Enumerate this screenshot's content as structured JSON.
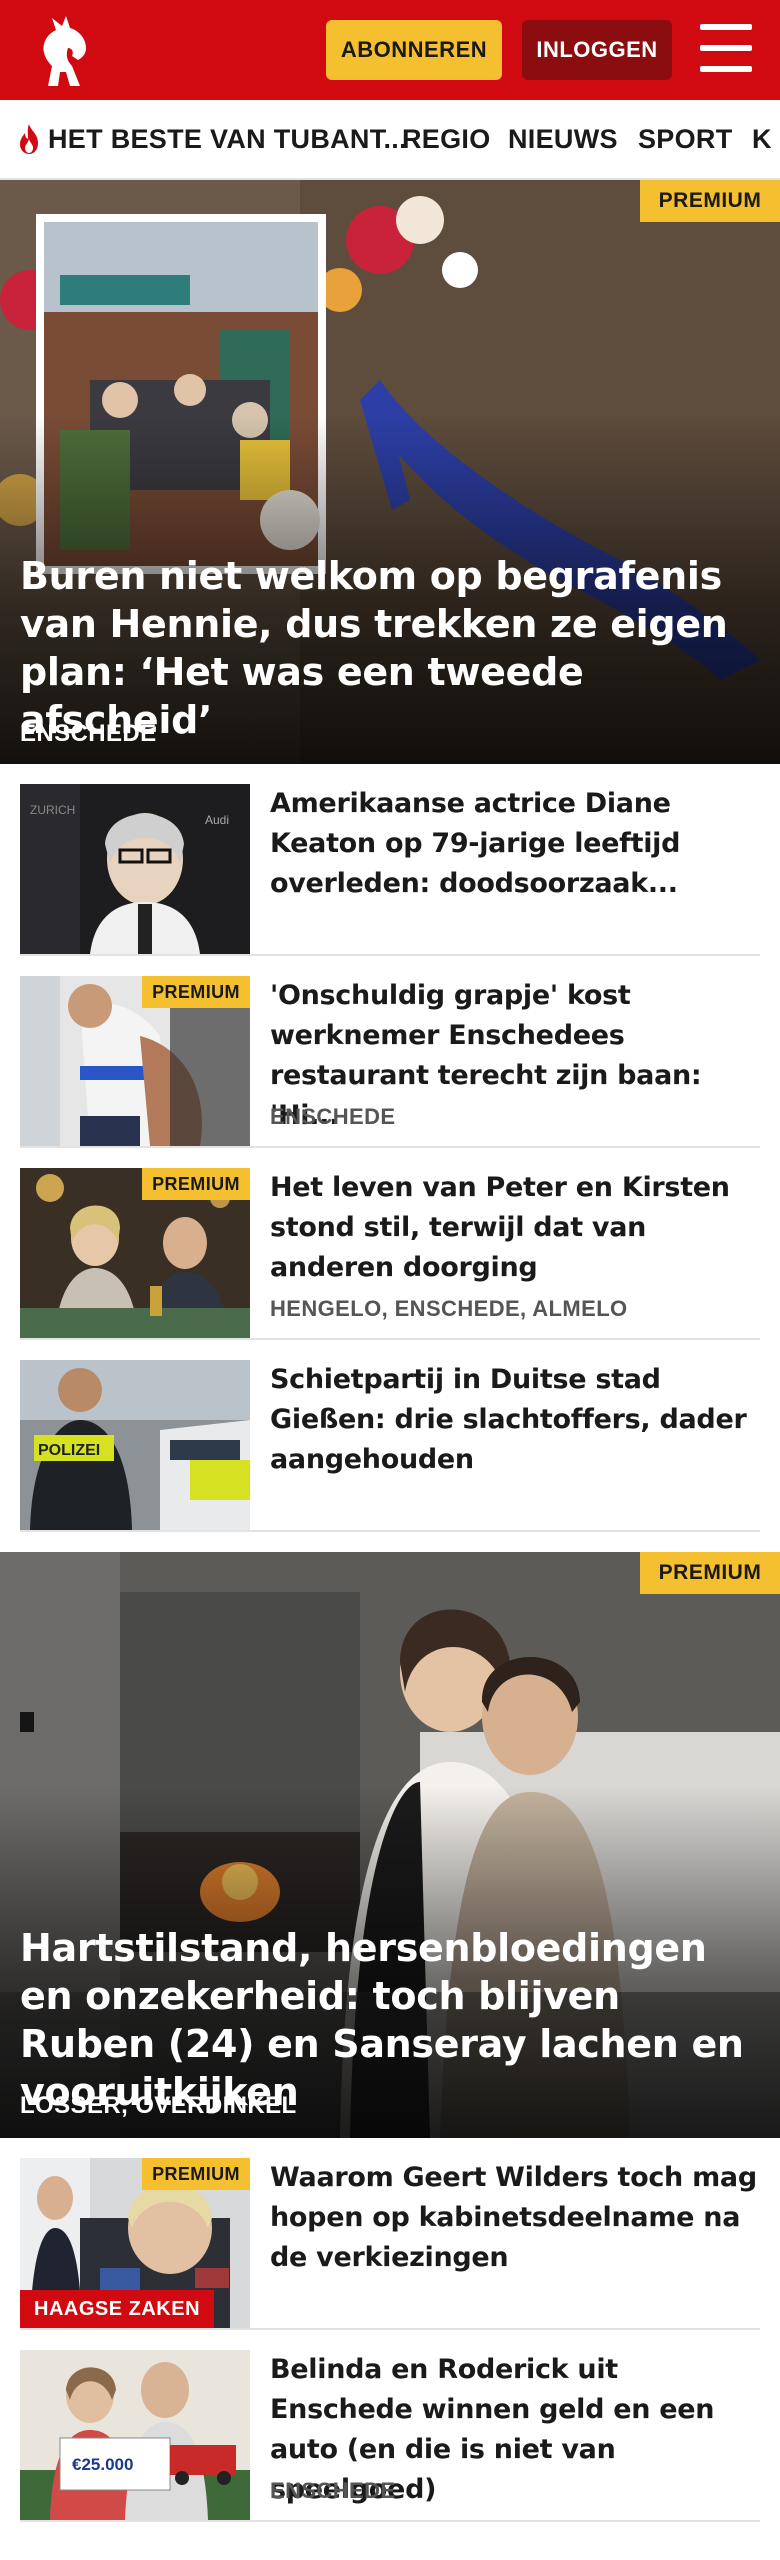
{
  "header": {
    "logo_name": "horse-logo",
    "subscribe_label": "ABONNEREN",
    "login_label": "INLOGGEN",
    "menu_icon": "hamburger-menu-icon",
    "brand_color": "#d10a11",
    "accent_color": "#f5c030"
  },
  "nav": {
    "items": [
      {
        "label": "HET BESTE VAN TUBANT...",
        "icon": "flame-icon"
      },
      {
        "label": "REGIO"
      },
      {
        "label": "NIEUWS"
      },
      {
        "label": "SPORT"
      },
      {
        "label": "K"
      }
    ]
  },
  "hero1": {
    "badge": "PREMIUM",
    "title": "Buren niet welkom op begrafenis van Hennie, dus trekken ze eigen plan: ‘Het was een tweede afscheid’",
    "location": "ENSCHEDE"
  },
  "list1": [
    {
      "title": "Amerikaanse actrice Diane Keaton op 79-jarige leeftijd overleden: doodsoorzaak...",
      "location": "",
      "premium": ""
    },
    {
      "title": "'Onschuldig grapje' kost werknemer Enschedees restaurant terecht zijn baan: 'Hi...",
      "location": "ENSCHEDE",
      "premium": "PREMIUM"
    },
    {
      "title": "Het leven van Peter en Kirsten stond stil, terwijl dat van anderen doorging",
      "location": "HENGELO, ENSCHEDE, ALMELO",
      "premium": "PREMIUM"
    },
    {
      "title": "Schietpartij in Duitse stad Gießen: drie slachtoffers, dader aangehouden",
      "location": "",
      "premium": ""
    }
  ],
  "hero2": {
    "badge": "PREMIUM",
    "title": "Hartstilstand, hersenbloedingen en onzekerheid: toch blijven Ruben (24) en Sanseray lachen en vooruitkijken",
    "location": "LOSSER, OVERDINKEL"
  },
  "list2": [
    {
      "title": "Waarom Geert Wilders toch mag hopen op kabinetsdeelname na de verkiezingen",
      "location": "",
      "premium": "PREMIUM",
      "tag": "HAAGSE ZAKEN"
    },
    {
      "title": "Belinda en Roderick uit Enschede winnen geld en een auto (en die is niet van speelgoed)",
      "location": "ENSCHEDE",
      "premium": "",
      "tag": ""
    }
  ],
  "thumb_text": {
    "police": "POLIZEI",
    "cheque": "€25.000"
  }
}
